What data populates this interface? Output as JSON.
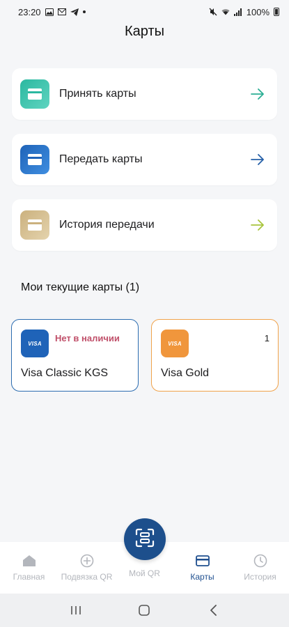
{
  "status_bar": {
    "time": "23:20",
    "battery": "100%"
  },
  "page_title": "Карты",
  "actions": [
    {
      "label": "Принять карты",
      "icon": "card-icon",
      "color": "#2bb8a0",
      "color2": "#5fd4c0",
      "arrow_color": "#2bae94"
    },
    {
      "label": "Передать карты",
      "icon": "card-icon",
      "color": "#1f63b8",
      "color2": "#3f8ee0",
      "arrow_color": "#2660a8"
    },
    {
      "label": "История передачи",
      "icon": "card-icon",
      "color": "#cbb17e",
      "color2": "#e4d3ad",
      "arrow_color": "#a8c43c"
    }
  ],
  "section_title": "Мои текущие карты (1)",
  "cards": [
    {
      "name": "Visa Classic KGS",
      "status": "Нет в наличии",
      "count": "",
      "brand": "VISA",
      "color": "#1f63b8",
      "border": "#2b6cb0"
    },
    {
      "name": "Visa Gold",
      "status": "",
      "count": "1",
      "brand": "VISA",
      "color": "#f0963c",
      "border": "#f0a24a"
    }
  ],
  "nav": {
    "home": "Главная",
    "link_qr": "Подвязка QR",
    "my_qr": "Мой QR",
    "cards": "Карты",
    "history": "История"
  },
  "colors": {
    "accent": "#1d4f8c",
    "inactive": "#b3b6bc",
    "background": "#f5f6f8"
  }
}
